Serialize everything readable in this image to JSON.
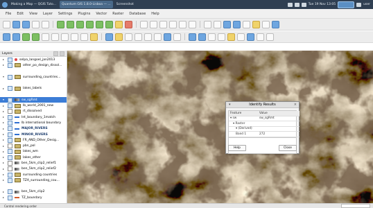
{
  "taskbar": {
    "tasks": [
      "Making a Map — QGIS Tuto...",
      "Quantum GIS 1.8.0-Lisboa — ...",
      "Screenshot"
    ],
    "clock": "Tue 19 Nov 13:05",
    "user": "user"
  },
  "menu": [
    "File",
    "Edit",
    "View",
    "Layer",
    "Settings",
    "Plugins",
    "Vector",
    "Raster",
    "Database",
    "Help"
  ],
  "layers_panel": {
    "title": "Layers",
    "items": [
      {
        "name": "selpa_langoel_jan2013",
        "sym": "point",
        "checked": true,
        "exp": "▸"
      },
      {
        "name": "other_po_design_dissol...",
        "sym": "poly",
        "checked": true,
        "exp": "▸"
      },
      {
        "name": "",
        "sym": "",
        "checked": false,
        "exp": ""
      },
      {
        "name": "surrounding_countries...",
        "sym": "poly",
        "checked": true,
        "exp": "▾"
      },
      {
        "name": "",
        "sym": "",
        "checked": false,
        "exp": ""
      },
      {
        "name": "lakes_labels",
        "sym": "poly",
        "checked": true,
        "exp": "▸"
      },
      {
        "name": "",
        "sym": "",
        "checked": false,
        "exp": ""
      },
      {
        "name": "sw_sgRmt",
        "sym": "raster",
        "checked": true,
        "exp": "▾",
        "selected": true
      },
      {
        "name": "lb_world_2001_new",
        "sym": "poly",
        "checked": true,
        "exp": "▸"
      },
      {
        "name": "rt_dissolved",
        "sym": "poly",
        "checked": false,
        "exp": "▸"
      },
      {
        "name": "Int_boundary_1match",
        "sym": "line",
        "checked": true,
        "exp": "▸"
      },
      {
        "name": "lb international boundary",
        "sym": "line",
        "checked": true,
        "exp": "▸"
      },
      {
        "name": "MAJOR_RIVERS",
        "sym": "line",
        "checked": true,
        "exp": "▸",
        "bold": true
      },
      {
        "name": "MINOR_RIVERS",
        "sym": "line",
        "checked": true,
        "exp": "▸",
        "bold": true
      },
      {
        "name": "FR_AND_Other_Desig...",
        "sym": "poly",
        "checked": true,
        "exp": "▸"
      },
      {
        "name": "pbn_pol",
        "sym": "poly",
        "checked": false,
        "exp": "▸"
      },
      {
        "name": "lakes_wm",
        "sym": "poly",
        "checked": true,
        "exp": "▸"
      },
      {
        "name": "lakes_other",
        "sym": "poly",
        "checked": true,
        "exp": "▸"
      },
      {
        "name": "ben_5km_clip2_relief1",
        "sym": "raster",
        "checked": false,
        "exp": "▸"
      },
      {
        "name": "ben_5km_clip2_relief2",
        "sym": "raster",
        "checked": false,
        "exp": "▸"
      },
      {
        "name": "surrounding countries",
        "sym": "poly",
        "checked": true,
        "exp": "▸"
      },
      {
        "name": "TZA_surrounding_cou...",
        "sym": "poly",
        "checked": true,
        "exp": "▸"
      },
      {
        "name": "",
        "sym": "",
        "checked": false,
        "exp": ""
      },
      {
        "name": "ben_5km_clip2",
        "sym": "raster",
        "checked": true,
        "exp": "▸"
      },
      {
        "name": "TZ_boundary",
        "sym": "line2",
        "checked": true,
        "exp": "▸"
      }
    ]
  },
  "identify": {
    "title": "Identify Results",
    "col_feature": "Feature",
    "col_value": "Value",
    "rows": [
      {
        "feature": "▾ sw",
        "value": "sw_sgRmt",
        "indent": 0
      },
      {
        "feature": "▾ Raster",
        "value": "",
        "indent": 1
      },
      {
        "feature": "▾ (Derived)",
        "value": "",
        "indent": 2
      },
      {
        "feature": "Band 1",
        "value": "272",
        "indent": 2
      }
    ],
    "help_label": "Help",
    "close_label": "Close"
  },
  "status": {
    "text": "Control rendering order"
  }
}
